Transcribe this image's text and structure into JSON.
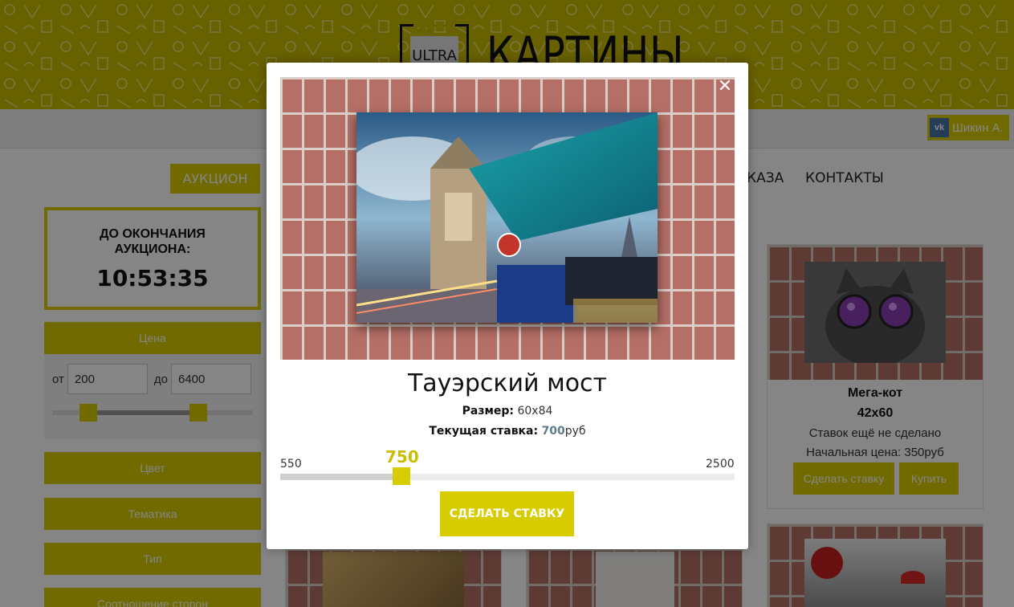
{
  "header": {
    "logo_small": "ULTRA",
    "logo_title": "КАРТИНЫ"
  },
  "navbar": {
    "vk_icon": "vk-icon",
    "user_name": "Шикин А."
  },
  "menu": {
    "auction": "АУКЦИОН",
    "order_partial": "КАЗА",
    "contacts": "КОНТАКТЫ"
  },
  "sidebar": {
    "timer_label": "ДО ОКОНЧАНИЯ АУКЦИОНА:",
    "timer_value": "10:53:35",
    "price_head": "Цена",
    "from_label": "от",
    "from_value": "200",
    "to_label": "до",
    "to_value": "6400",
    "filters": [
      "Цвет",
      "Тематика",
      "Тип",
      "Соотношение сторон"
    ]
  },
  "product_card": {
    "title": "Мега-кот",
    "size": "42x60",
    "status": "Ставок ещё не сделано",
    "start_price": "Начальная цена: 350руб",
    "bid_button": "Сделать ставку",
    "buy_button": "Купить"
  },
  "modal": {
    "close_icon": "close-icon",
    "title": "Тауэрский мост",
    "size_label": "Размер:",
    "size_value": "60x84",
    "bid_label": "Текущая ставка:",
    "bid_value": "700",
    "bid_unit": "руб",
    "slider_min": "550",
    "slider_max": "2500",
    "slider_value": "750",
    "slider_fraction": 0.1026,
    "submit": "СДЕЛАТЬ СТАВКУ"
  },
  "colors": {
    "accent": "#d6cc00",
    "header_bg": "#c7ba00",
    "bid_value": "#5e7a8c"
  }
}
